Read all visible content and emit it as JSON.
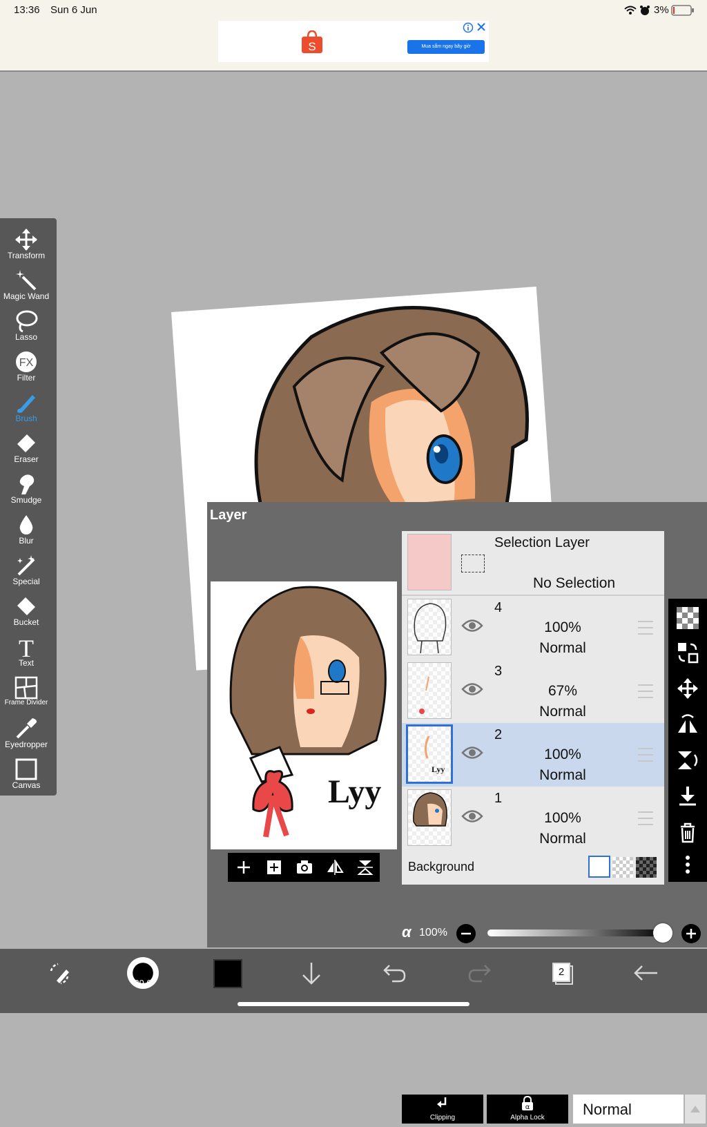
{
  "status_bar": {
    "time": "13:36",
    "date": "Sun 6 Jun",
    "battery": "3%"
  },
  "ad": {
    "button_label": "Mua sắm ngay bây giờ"
  },
  "tools": [
    {
      "label": "Transform",
      "icon": "move-arrows-icon"
    },
    {
      "label": "Magic Wand",
      "icon": "magic-wand-icon"
    },
    {
      "label": "Lasso",
      "icon": "lasso-icon"
    },
    {
      "label": "Filter",
      "icon": "fx-icon"
    },
    {
      "label": "Brush",
      "icon": "brush-icon",
      "active": true
    },
    {
      "label": "Eraser",
      "icon": "eraser-icon"
    },
    {
      "label": "Smudge",
      "icon": "smudge-icon"
    },
    {
      "label": "Blur",
      "icon": "droplet-icon"
    },
    {
      "label": "Special",
      "icon": "sparkle-wand-icon"
    },
    {
      "label": "Bucket",
      "icon": "bucket-icon"
    },
    {
      "label": "Text",
      "icon": "text-t-icon"
    },
    {
      "label": "Frame Divider",
      "icon": "frame-divider-icon"
    },
    {
      "label": "Eyedropper",
      "icon": "eyedropper-icon"
    },
    {
      "label": "Canvas",
      "icon": "canvas-icon"
    }
  ],
  "layer_panel": {
    "title": "Layer",
    "selection_layer": {
      "name": "Selection Layer",
      "status": "No Selection"
    },
    "layers": [
      {
        "number": "4",
        "opacity": "100%",
        "mode": "Normal",
        "selected": false
      },
      {
        "number": "3",
        "opacity": "67%",
        "mode": "Normal",
        "selected": false
      },
      {
        "number": "2",
        "opacity": "100%",
        "mode": "Normal",
        "selected": true
      },
      {
        "number": "1",
        "opacity": "100%",
        "mode": "Normal",
        "selected": false
      }
    ],
    "background_label": "Background",
    "clipping_label": "Clipping",
    "alpha_lock_label": "Alpha Lock",
    "blend_mode": "Normal",
    "alpha_symbol": "α",
    "opacity_value": "100%",
    "opacity_fraction": 1.0
  },
  "canvas_art": {
    "signature": "Lyy"
  },
  "bottom_bar": {
    "brush_size": "29.0",
    "layer_count": "2",
    "current_color": "#000000"
  },
  "colors": {
    "accent_blue": "#3a9be6",
    "selected_row": "#c9d8ec",
    "hair_brown": "#8b6a52"
  }
}
